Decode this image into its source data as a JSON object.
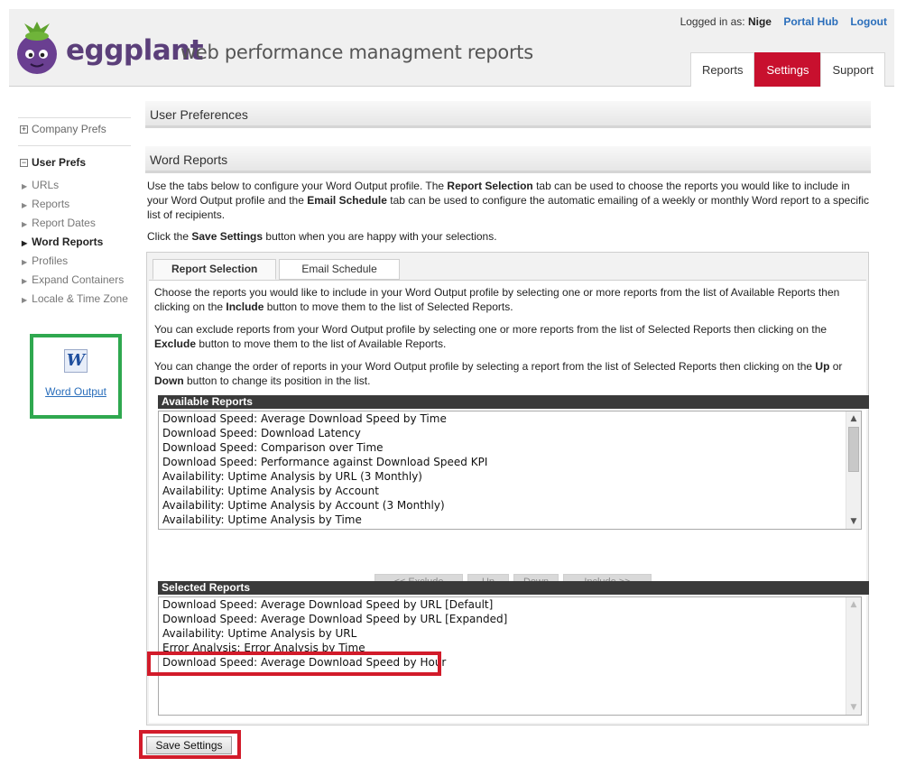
{
  "header": {
    "brand": "eggplant",
    "tagline": "web performance managment reports",
    "logged_in_prefix": "Logged in as:",
    "user": "Nige",
    "portal_hub": "Portal Hub",
    "logout": "Logout",
    "tabs": [
      {
        "label": "Reports",
        "active": false
      },
      {
        "label": "Settings",
        "active": true
      },
      {
        "label": "Support",
        "active": false
      }
    ]
  },
  "sidebar": {
    "company_prefs": "Company Prefs",
    "user_prefs": "User Prefs",
    "items": [
      {
        "label": "URLs"
      },
      {
        "label": "Reports"
      },
      {
        "label": "Report Dates"
      },
      {
        "label": "Word Reports",
        "active": true
      },
      {
        "label": "Profiles"
      },
      {
        "label": "Expand Containers"
      },
      {
        "label": "Locale & Time Zone"
      }
    ],
    "word_output_link": "Word Output"
  },
  "main": {
    "user_prefs_title": "User Preferences",
    "word_reports_title": "Word Reports",
    "intro": {
      "t1": "Use the tabs below to configure your Word Output profile. The ",
      "b1": "Report Selection",
      "t2": " tab can be used to choose the reports you would like to include in your Word Output profile and the ",
      "b2": "Email Schedule",
      "t3": " tab can be used to configure the automatic emailing of a weekly or monthly Word report to a specific list of recipients."
    },
    "save_hint": {
      "t1": "Click the ",
      "b1": "Save Settings",
      "t2": " button when you are happy with your selections."
    },
    "tabs": [
      {
        "label": "Report Selection",
        "active": true
      },
      {
        "label": "Email Schedule",
        "active": false
      }
    ],
    "p1": {
      "t1": "Choose the reports you would like to include in your Word Output profile by selecting one or more reports from the list of Available Reports then clicking on the ",
      "b1": "Include",
      "t2": " button to move them to the list of Selected Reports."
    },
    "p2": {
      "t1": "You can exclude reports from your Word Output profile by selecting one or more reports from the list of Selected Reports then clicking on the ",
      "b1": "Exclude",
      "t2": " button to move them to the list of Available Reports."
    },
    "p3": {
      "t1": "You can change the order of reports in your Word Output profile by selecting a report from the list of Selected Reports then clicking on the ",
      "b1": "Up",
      "t2": " or ",
      "b2": "Down",
      "t3": " button to change its position in the list."
    },
    "available_title": "Available Reports",
    "available": [
      "Download Speed: Average Download Speed by Time",
      "Download Speed: Download Latency",
      "Download Speed: Comparison over Time",
      "Download Speed: Performance against Download Speed KPI",
      "Availability: Uptime Analysis by URL (3 Monthly)",
      "Availability: Uptime Analysis by Account",
      "Availability: Uptime Analysis by Account (3 Monthly)",
      "Availability: Uptime Analysis by Time"
    ],
    "buttons": {
      "exclude": "<< Exclude",
      "up": "Up",
      "down": "Down",
      "include": "Include >>"
    },
    "selected_title": "Selected Reports",
    "selected": [
      "Download Speed: Average Download Speed by URL [Default]",
      "Download Speed: Average Download Speed by URL [Expanded]",
      "Availability: Uptime Analysis by URL",
      "Error Analysis: Error Analysis by Time",
      "Download Speed: Average Download Speed by Hour"
    ],
    "save_button": "Save Settings"
  },
  "colors": {
    "accent": "#c8102e",
    "brand": "#5b3f7a",
    "link": "#2a6ebb",
    "highlight_green": "#2fa84f",
    "highlight_red": "#d21b2a"
  }
}
